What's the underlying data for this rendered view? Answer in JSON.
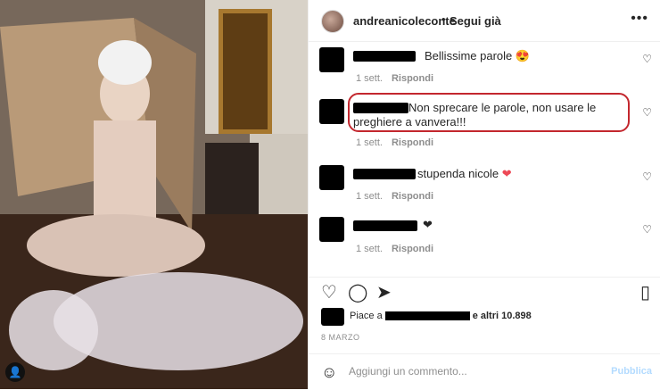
{
  "post": {
    "username": "andreanicoleconte",
    "separator": "•",
    "follow_label": "Segui già",
    "more_icon": "more-horizontal-icon"
  },
  "comments": [
    {
      "text": "Bellissime parole 😍",
      "time": "1 sett.",
      "reply": "Rispondi"
    },
    {
      "text": "Non sprecare le parole, non usare le preghiere a vanvera!!!",
      "time": "1 sett.",
      "reply": "Rispondi"
    },
    {
      "text": "stupenda nicole",
      "heart": "❤",
      "time": "1 sett.",
      "reply": "Rispondi"
    },
    {
      "text": "",
      "heart": "❤",
      "time": "1 sett.",
      "reply": "Rispondi"
    }
  ],
  "likes": {
    "prefix": "Piace a",
    "suffix": "e altri 10.898"
  },
  "date": "8 MARZO",
  "composer": {
    "placeholder": "Aggiungi un commento...",
    "post_label": "Pubblica"
  },
  "colors": {
    "highlight": "#c3272e",
    "heart": "#ed4956",
    "post_disabled": "#b3dbff"
  }
}
